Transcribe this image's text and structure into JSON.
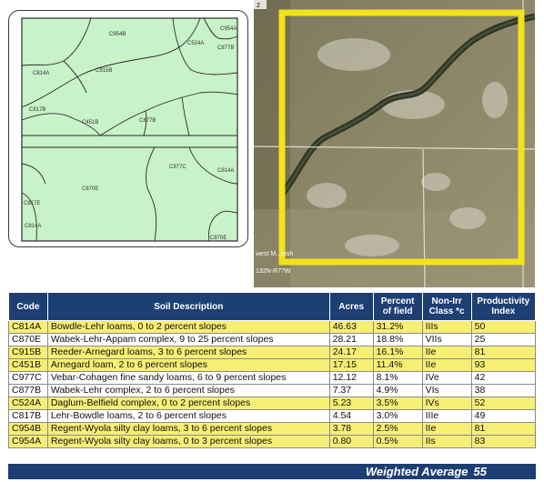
{
  "soil_map": {
    "labels": [
      "C954B",
      "C524A",
      "C954A",
      "C877B",
      "C915B",
      "C814A",
      "C817B",
      "C451B",
      "C877B",
      "C977C",
      "C814A",
      "C870E",
      "C817E",
      "C814A",
      "C870E"
    ]
  },
  "aerial": {
    "corner_label": "2",
    "twp_label": "west M...tosh",
    "range_label": "132N-R7?W",
    "boundary_color": "#f2e21a"
  },
  "table": {
    "headers": {
      "code": "Code",
      "desc": "Soil Description",
      "acres": "Acres",
      "pct_line1": "Percent",
      "pct_line2": "of field",
      "class_line1": "Non-Irr",
      "class_line2": "Class *c",
      "pi_line1": "Productivity",
      "pi_line2": "Index"
    },
    "rows": [
      {
        "code": "C814A",
        "desc": "Bowdle-Lehr loams, 0 to 2 percent slopes",
        "acres": "46.63",
        "pct": "31.2%",
        "cls": "IIIs",
        "pi": "50",
        "highlight": true
      },
      {
        "code": "C870E",
        "desc": "Wabek-Lehr-Appam complex, 9 to 25 percent slopes",
        "acres": "28.21",
        "pct": "18.8%",
        "cls": "VIIs",
        "pi": "25",
        "highlight": false
      },
      {
        "code": "C915B",
        "desc": "Reeder-Arnegard loams, 3 to 6 percent slopes",
        "acres": "24.17",
        "pct": "16.1%",
        "cls": "IIe",
        "pi": "81",
        "highlight": true
      },
      {
        "code": "C451B",
        "desc": "Arnegard loam, 2 to 6 percent slopes",
        "acres": "17.15",
        "pct": "11.4%",
        "cls": "IIe",
        "pi": "93",
        "highlight": true
      },
      {
        "code": "C977C",
        "desc": "Vebar-Cohagen fine sandy loams, 6 to 9 percent slopes",
        "acres": "12.12",
        "pct": "8.1%",
        "cls": "IVe",
        "pi": "42",
        "highlight": false
      },
      {
        "code": "C877B",
        "desc": "Wabek-Lehr complex, 2 to 6 percent slopes",
        "acres": "7.37",
        "pct": "4.9%",
        "cls": "VIs",
        "pi": "38",
        "highlight": false
      },
      {
        "code": "C524A",
        "desc": "Daglum-Belfield complex, 0 to 2 percent slopes",
        "acres": "5.23",
        "pct": "3.5%",
        "cls": "IVs",
        "pi": "52",
        "highlight": true
      },
      {
        "code": "C817B",
        "desc": "Lehr-Bowdle loams, 2 to 6 percent slopes",
        "acres": "4.54",
        "pct": "3.0%",
        "cls": "IIIe",
        "pi": "49",
        "highlight": false
      },
      {
        "code": "C954B",
        "desc": "Regent-Wyola silty clay loams, 3 to 6 percent slopes",
        "acres": "3.78",
        "pct": "2.5%",
        "cls": "IIe",
        "pi": "81",
        "highlight": true
      },
      {
        "code": "C954A",
        "desc": "Regent-Wyola silty clay loams, 0 to 3 percent slopes",
        "acres": "0.80",
        "pct": "0.5%",
        "cls": "IIs",
        "pi": "83",
        "highlight": true
      }
    ],
    "weighted_average_label": "Weighted Average",
    "weighted_average_value": "55",
    "colors": {
      "header_bg": "#1d3f73",
      "highlight": "#f6ef74",
      "map_fill": "#c8f2c8"
    }
  }
}
